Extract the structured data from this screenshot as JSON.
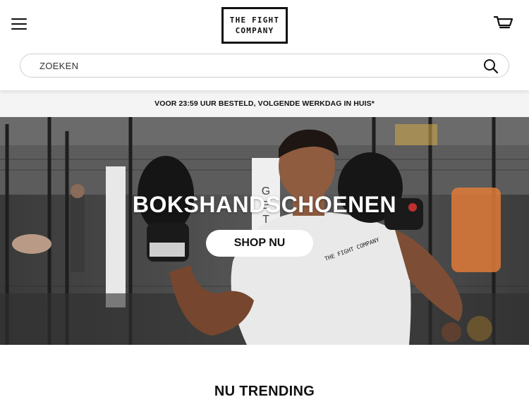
{
  "header": {
    "menu_icon": "hamburger-menu-icon",
    "logo": {
      "line1": "THE FIGHT",
      "line2": "COMPANY"
    },
    "cart_icon": "shopping-cart-icon"
  },
  "search": {
    "placeholder": "ZOEKEN",
    "value": "",
    "icon": "search-icon"
  },
  "announcement": {
    "text": "VOOR 23:59 UUR BESTELD, VOLGENDE WERKDAG IN HUIS*"
  },
  "hero": {
    "title": "BOKSHANDSCHOENEN",
    "button_label": "SHOP NU",
    "shirt_print": "THE FIGHT COMPANY",
    "banner_letters": "G E T  E R"
  },
  "sections": {
    "trending_title": "NU TRENDING"
  },
  "colors": {
    "text": "#111111",
    "announcement_bg": "#f4f4f4",
    "header_bg": "#ffffff"
  }
}
